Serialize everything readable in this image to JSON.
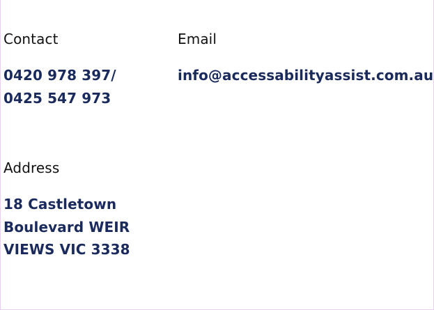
{
  "contact": {
    "label": "Contact",
    "phone_lines": [
      "0420 978 397/",
      "0425 547 973"
    ]
  },
  "email": {
    "label": "Email",
    "address": "info@accessabilityassist.com.au"
  },
  "address": {
    "label": "Address",
    "lines": [
      "18 Castletown",
      "Boulevard WEIR",
      "VIEWS VIC 3338"
    ]
  },
  "colors": {
    "value_text": "#1a2a5c",
    "label_text": "#111111",
    "frame_border": "#e9cff0"
  }
}
